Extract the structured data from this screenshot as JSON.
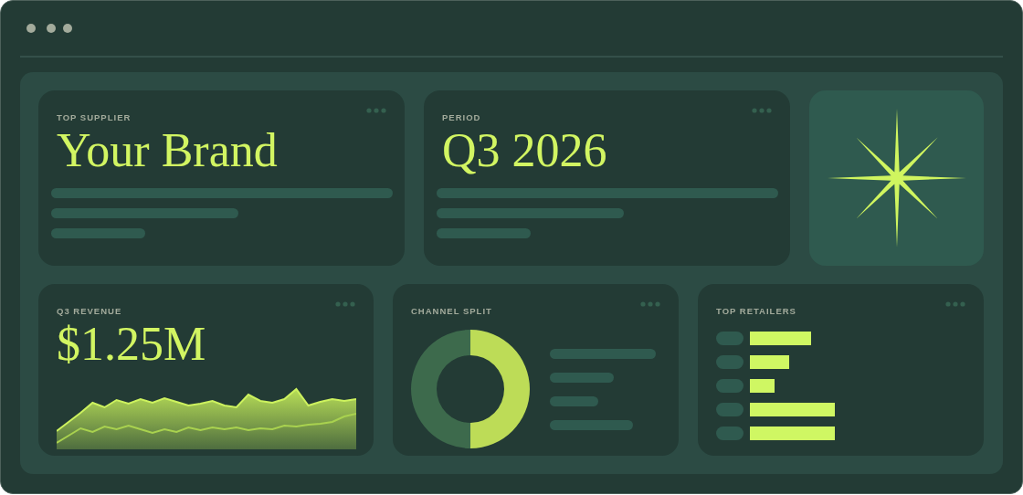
{
  "cards": [
    {
      "kind": "text",
      "label": "TOP SUPPLIER",
      "value": "Your Brand"
    },
    {
      "kind": "text",
      "label": "PERIOD",
      "value": "Q3 2026"
    },
    {
      "kind": "star"
    },
    {
      "kind": "revenue",
      "label": "Q3 REVENUE",
      "value": "$1.25M"
    },
    {
      "kind": "donut",
      "label": "CHANNEL SPLIT"
    },
    {
      "kind": "bars",
      "label": "TOP RETAILERS"
    }
  ]
}
